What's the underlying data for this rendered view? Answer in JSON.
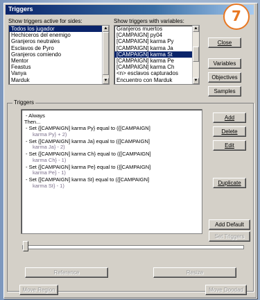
{
  "window": {
    "title": "Triggers"
  },
  "badge": "7",
  "labels": {
    "sides": "Show triggers active for sides:",
    "variables": "Show triggers with variables:",
    "triggers_group": "Triggers"
  },
  "sides_list": [
    {
      "label": "Todos los jugador",
      "selected": true
    },
    {
      "label": "Hechiceros del enemigo",
      "selected": false
    },
    {
      "label": "Granjeros neutrales",
      "selected": false
    },
    {
      "label": "Esclavos de Pyro",
      "selected": false
    },
    {
      "label": "Granjeros comiendo",
      "selected": false
    },
    {
      "label": "Mentor",
      "selected": false
    },
    {
      "label": "Feastus",
      "selected": false
    },
    {
      "label": "Vanya",
      "selected": false
    },
    {
      "label": "Marduk",
      "selected": false
    }
  ],
  "variables_list": [
    {
      "label": "Granjeros muertos",
      "selected": false
    },
    {
      "label": "[CAMPAIGN] py04",
      "selected": false
    },
    {
      "label": "[CAMPAIGN] karma Py",
      "selected": false
    },
    {
      "label": "[CAMPAIGN] karma Ja",
      "selected": false
    },
    {
      "label": "[CAMPAIGN] karma St",
      "selected": true
    },
    {
      "label": "[CAMPAIGN] karma Pe",
      "selected": false
    },
    {
      "label": "[CAMPAIGN] karma Ch",
      "selected": false
    },
    {
      "label": "<n> esclavos capturados",
      "selected": false
    },
    {
      "label": "Encuentro con Marduk",
      "selected": false
    }
  ],
  "right_buttons": {
    "close": "Close",
    "variables": "Variables",
    "objectives": "Objectives",
    "samples": "Samples"
  },
  "trigger_text": {
    "always": "- Always",
    "then": "Then...",
    "lines": [
      {
        "a": "- Set {[CAMPAIGN] karma Py} equal to ({[CAMPAIGN]",
        "b": "karma Py} + 2)"
      },
      {
        "a": "- Set {[CAMPAIGN] karma Ja} equal to ({[CAMPAIGN]",
        "b": "karma Ja} - 2)"
      },
      {
        "a": "- Set {[CAMPAIGN] karma Ch} equal to ({[CAMPAIGN]",
        "b": "karma Ch} - 1)"
      },
      {
        "a": "- Set {[CAMPAIGN] karma Pe} equal to ({[CAMPAIGN]",
        "b": "karma Pe} - 1)"
      },
      {
        "a": "- Set {[CAMPAIGN] karma St} equal to ({[CAMPAIGN]",
        "b": "karma St} - 1)"
      }
    ]
  },
  "trigger_buttons": {
    "add": "Add",
    "delete": "Delete",
    "edit": "Edit",
    "duplicate": "Duplicate",
    "add_default": "Add Default",
    "set_triggers": "Set Triggers"
  },
  "bottom_buttons": {
    "left": "Reference",
    "right": "Resize",
    "left2": "Move Region",
    "right2": "Move Doodad"
  }
}
